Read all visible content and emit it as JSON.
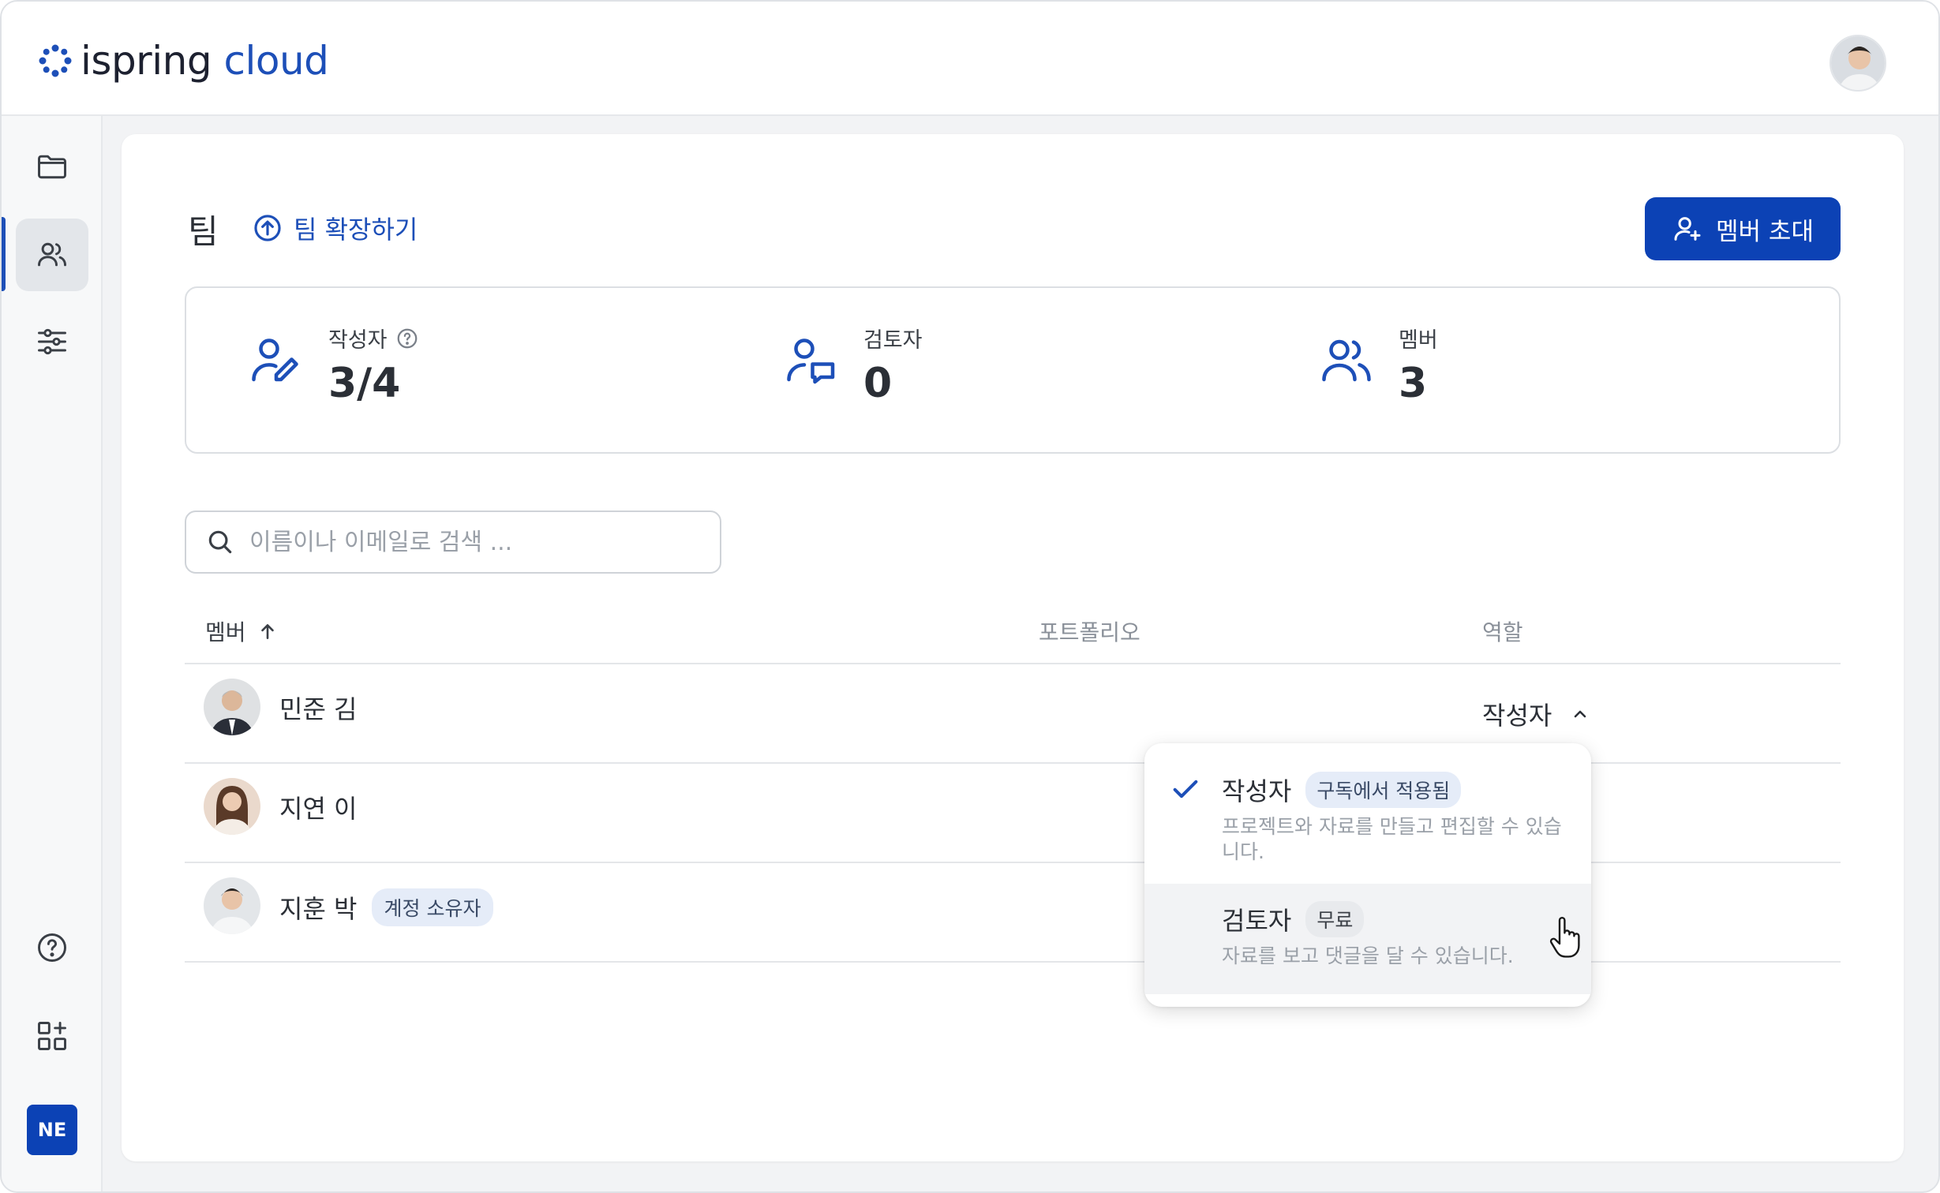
{
  "brand": {
    "logo_part1": "ispring",
    "logo_part2": "cloud",
    "accent": "#0c42b5"
  },
  "header": {
    "avatar": "user-avatar"
  },
  "sidebar": {
    "items": [
      {
        "icon": "folder-icon",
        "active": false
      },
      {
        "icon": "users-icon",
        "active": true
      },
      {
        "icon": "sliders-icon",
        "active": false
      }
    ],
    "bottom": [
      {
        "icon": "help-icon"
      },
      {
        "icon": "apps-add-icon"
      }
    ],
    "user_initials": "NE"
  },
  "page": {
    "title": "팀",
    "expand_link": "팀 확장하기",
    "invite_button": "멤버 초대"
  },
  "stats": [
    {
      "label": "작성자",
      "value": "3/4",
      "icon": "author-icon",
      "help": true
    },
    {
      "label": "검토자",
      "value": "0",
      "icon": "reviewer-icon",
      "help": false
    },
    {
      "label": "멤버",
      "value": "3",
      "icon": "members-icon",
      "help": false
    }
  ],
  "search": {
    "placeholder": "이름이나 이메일로 검색 ...",
    "value": ""
  },
  "table": {
    "columns": {
      "member": "멤버",
      "portfolio": "포트폴리오",
      "role": "역할"
    },
    "rows": [
      {
        "name": "민준 김",
        "role": "작성자",
        "tag": ""
      },
      {
        "name": "지연 이",
        "role": "",
        "tag": ""
      },
      {
        "name": "지훈 박",
        "role": "",
        "tag": "계정 소유자"
      }
    ]
  },
  "role_dropdown": {
    "options": [
      {
        "label": "작성자",
        "tag": "구독에서 적용됨",
        "desc": "프로젝트와 자료를 만들고 편집할 수 있습니다.",
        "selected": true
      },
      {
        "label": "검토자",
        "tag": "무료",
        "desc": "자료를 보고 댓글을 달 수 있습니다.",
        "selected": false
      }
    ]
  }
}
